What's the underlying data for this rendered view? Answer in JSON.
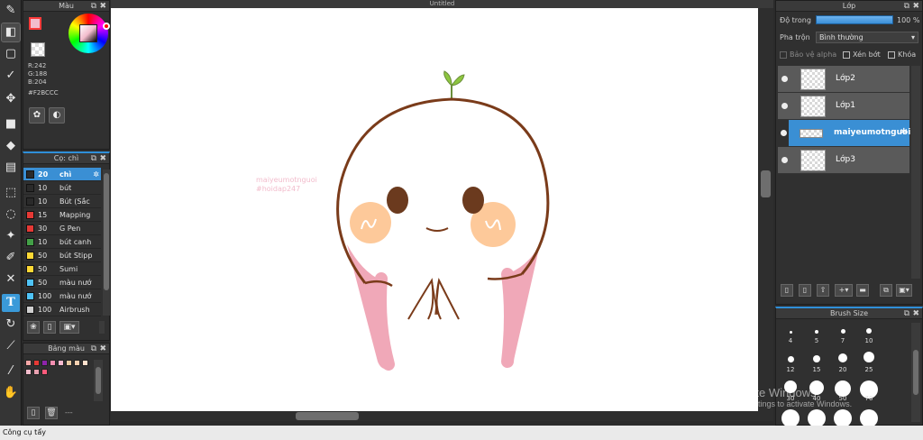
{
  "document": {
    "title": "Untitled"
  },
  "color_panel": {
    "title": "Màu",
    "foreground": "#F2BCCC",
    "r_label": "R:242",
    "g_label": "G:188",
    "b_label": "B:204",
    "hex_label": "#F2BCCC"
  },
  "brush_panel": {
    "title": "Cọ: chì",
    "items": [
      {
        "size": "20",
        "name": "chì",
        "color": "#2a2a2a"
      },
      {
        "size": "10",
        "name": "bút",
        "color": "#2a2a2a"
      },
      {
        "size": "10",
        "name": "Bút (Sắc",
        "color": "#2a2a2a"
      },
      {
        "size": "15",
        "name": "Mapping",
        "color": "#e53935"
      },
      {
        "size": "30",
        "name": "G Pen",
        "color": "#e53935"
      },
      {
        "size": "10",
        "name": "bút canh",
        "color": "#43a047"
      },
      {
        "size": "50",
        "name": "bút Stipp",
        "color": "#fdd835"
      },
      {
        "size": "50",
        "name": "Sumi",
        "color": "#fdd835"
      },
      {
        "size": "50",
        "name": "màu nướ",
        "color": "#4fc3f7"
      },
      {
        "size": "100",
        "name": "màu nướ",
        "color": "#4fc3f7"
      },
      {
        "size": "100",
        "name": "Airbrush",
        "color": "#d0d0d0"
      }
    ]
  },
  "palette_panel": {
    "title": "Bảng màu",
    "swatches": [
      "#f4a6a6",
      "#e53935",
      "#8e24aa",
      "#f48fb1",
      "#f8bbd0",
      "#e8c9a0",
      "#f5d0b0",
      "#ffe0cc",
      "#f2bccc",
      "#e8a0b0",
      "#ff5a7a"
    ],
    "footer": "---"
  },
  "canvas": {
    "watermark_line1": "maiyeumotnguoi",
    "watermark_line2": "#hoidap247"
  },
  "layer_panel": {
    "title": "Lớp",
    "opacity_label": "Độ trong",
    "opacity_value": "100 %",
    "opacity": 1.0,
    "blend_label": "Pha trộn",
    "blend_value": "Bình thường",
    "protect_alpha": "Bảo vệ alpha",
    "clip": "Xén bớt",
    "lock": "Khóa",
    "layers": [
      {
        "name": "Lớp2",
        "selected": false
      },
      {
        "name": "Lớp1",
        "selected": false
      },
      {
        "name": "maiyeumotnguoi",
        "selected": true
      },
      {
        "name": "Lớp3",
        "selected": false
      }
    ]
  },
  "brush_size_panel": {
    "title": "Brush Size",
    "sizes": [
      "4",
      "5",
      "7",
      "10",
      "12",
      "15",
      "20",
      "25",
      "30",
      "40",
      "50",
      "70"
    ]
  },
  "watermark_os": {
    "line1": "Activate Windows",
    "line2": "Go to Settings to activate Windows."
  },
  "status": {
    "text": "Công cụ tẩy"
  }
}
